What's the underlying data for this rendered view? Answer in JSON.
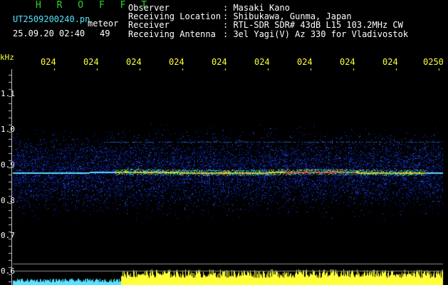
{
  "header": {
    "brand": "H R O F F T",
    "filename": "UT2509200240.pn",
    "kind": "meteor",
    "datetime": "25.09.20 02:40",
    "count": "49",
    "meta_labels": "Observer\nReceiving Location\nReceiver\nReceiving Antenna",
    "meta_values": ": Masaki Kano\n: Shibukawa, Gunma, Japan\n: RTL-SDR SDR# 43dB L15 103.2MHz CW\n: 3el Yagi(V) Az 330 for Vladivostok"
  },
  "axes": {
    "unit": "kHz",
    "time_ticks": [
      "024",
      "024",
      "024",
      "024",
      "024",
      "024",
      "024",
      "024",
      "024",
      "0250"
    ],
    "freq_ticks": [
      "1.1",
      "1.0",
      "0.9",
      "0.8",
      "0.7",
      "0.6"
    ]
  },
  "colors": {
    "background": "#000000",
    "brand": "#2bd62b",
    "filename": "#57e3ff",
    "ticks": "#ffff3a",
    "signal_trace": "#ff2020",
    "noise": "#1a3cff",
    "power_bars": "#ffff3a",
    "power_bars_left": "#57e3ff"
  }
}
